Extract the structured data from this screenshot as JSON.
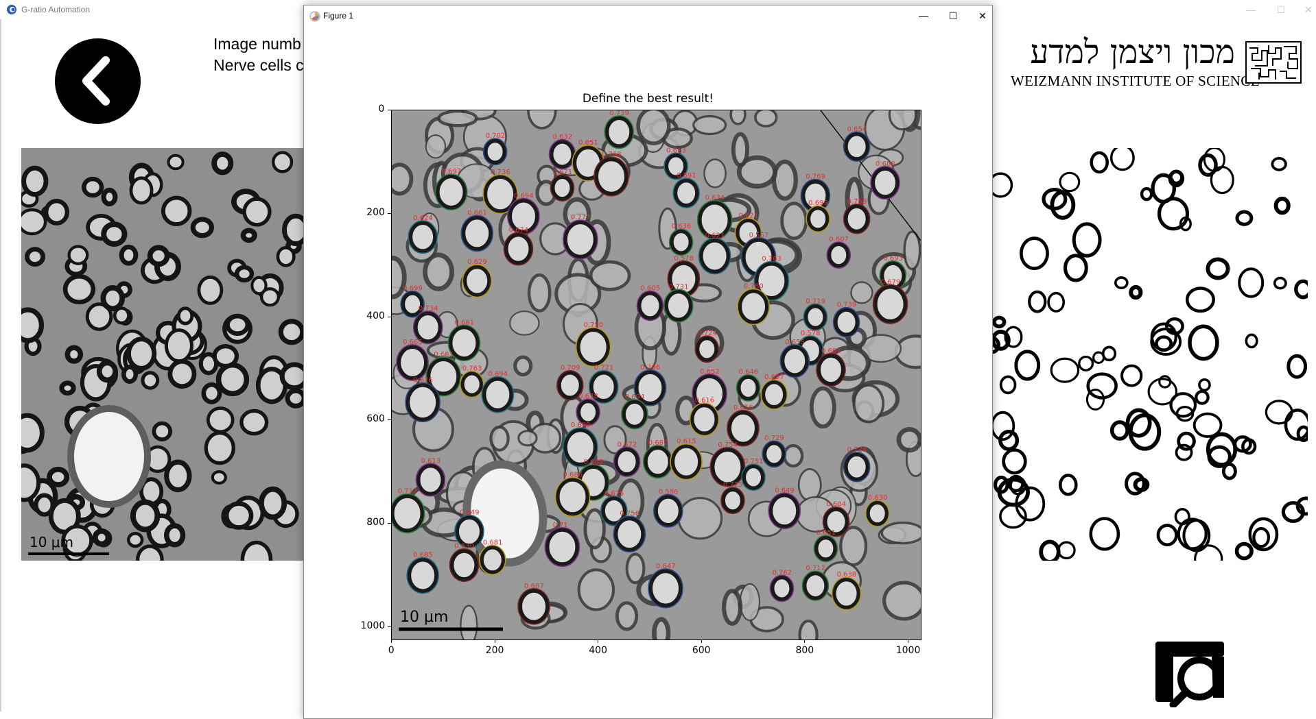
{
  "app": {
    "title": "G-ratio Automation",
    "controls": [
      "minimize-button",
      "maximize-button",
      "close-button"
    ],
    "info_line1": "Image numb",
    "info_line2": "Nerve cells c",
    "back_button": "chevron-left-icon",
    "magnify_button": "magnify-icon",
    "left_scale_label": "10 μm"
  },
  "logo": {
    "hebrew": "מכון ויצמן למדע",
    "english": "WEIZMANN INSTITUTE OF SCIENCE"
  },
  "figure_window": {
    "title": "Figure 1",
    "icon": "matplotlib-icon",
    "minimize": "—",
    "maximize": "☐",
    "close": "✕"
  },
  "plot": {
    "title": "Define the best result!",
    "scale_label": "10 μm"
  },
  "chart_data": {
    "type": "scatter",
    "title": "Define the best result!",
    "xlabel": "",
    "ylabel": "",
    "xlim": [
      0,
      1024
    ],
    "ylim": [
      1024,
      0
    ],
    "x_ticks": [
      0,
      200,
      400,
      600,
      800,
      1000
    ],
    "y_ticks": [
      0,
      200,
      400,
      600,
      800,
      1000
    ],
    "grid": false,
    "colors": {
      "label": "#e0302c",
      "image_bg": "#9a9a9a"
    },
    "points": [
      {
        "x": 200,
        "y": 80,
        "label": "0.702"
      },
      {
        "x": 330,
        "y": 85,
        "label": "0.632"
      },
      {
        "x": 440,
        "y": 42,
        "label": "0.739"
      },
      {
        "x": 380,
        "y": 102,
        "label": "0.651"
      },
      {
        "x": 425,
        "y": 128,
        "label": "0.768"
      },
      {
        "x": 550,
        "y": 108,
        "label": "0.613"
      },
      {
        "x": 900,
        "y": 70,
        "label": "0.654"
      },
      {
        "x": 955,
        "y": 140,
        "label": "0.668"
      },
      {
        "x": 115,
        "y": 158,
        "label": "0.697"
      },
      {
        "x": 210,
        "y": 162,
        "label": "0.736"
      },
      {
        "x": 330,
        "y": 150,
        "label": "0.671"
      },
      {
        "x": 570,
        "y": 160,
        "label": "0.591"
      },
      {
        "x": 820,
        "y": 165,
        "label": "0.769"
      },
      {
        "x": 255,
        "y": 205,
        "label": "0.694"
      },
      {
        "x": 625,
        "y": 212,
        "label": "0.634"
      },
      {
        "x": 825,
        "y": 210,
        "label": "0.699"
      },
      {
        "x": 900,
        "y": 210,
        "label": "0.758"
      },
      {
        "x": 60,
        "y": 245,
        "label": "0.624"
      },
      {
        "x": 165,
        "y": 238,
        "label": "0.661"
      },
      {
        "x": 365,
        "y": 250,
        "label": "0.777"
      },
      {
        "x": 560,
        "y": 255,
        "label": "0.636"
      },
      {
        "x": 690,
        "y": 237,
        "label": "0.621"
      },
      {
        "x": 245,
        "y": 268,
        "label": "0.674"
      },
      {
        "x": 625,
        "y": 282,
        "label": "0.621"
      },
      {
        "x": 710,
        "y": 284,
        "label": "0.567"
      },
      {
        "x": 865,
        "y": 280,
        "label": "0.607"
      },
      {
        "x": 970,
        "y": 320,
        "label": "0.693"
      },
      {
        "x": 165,
        "y": 330,
        "label": "0.629"
      },
      {
        "x": 565,
        "y": 326,
        "label": "0.578"
      },
      {
        "x": 735,
        "y": 330,
        "label": "0.763"
      },
      {
        "x": 40,
        "y": 375,
        "label": "0.699"
      },
      {
        "x": 500,
        "y": 378,
        "label": "0.605"
      },
      {
        "x": 555,
        "y": 378,
        "label": "0.731"
      },
      {
        "x": 700,
        "y": 380,
        "label": "0.780"
      },
      {
        "x": 965,
        "y": 375,
        "label": "0.679"
      },
      {
        "x": 820,
        "y": 400,
        "label": "0.719"
      },
      {
        "x": 880,
        "y": 410,
        "label": "0.739"
      },
      {
        "x": 70,
        "y": 420,
        "label": "0.734"
      },
      {
        "x": 140,
        "y": 450,
        "label": "0.681"
      },
      {
        "x": 390,
        "y": 458,
        "label": "0.790"
      },
      {
        "x": 610,
        "y": 462,
        "label": "0.724"
      },
      {
        "x": 810,
        "y": 465,
        "label": "0.578"
      },
      {
        "x": 780,
        "y": 485,
        "label": "0.655"
      },
      {
        "x": 40,
        "y": 488,
        "label": "0.665"
      },
      {
        "x": 100,
        "y": 515,
        "label": "0.681"
      },
      {
        "x": 155,
        "y": 530,
        "label": "0.763"
      },
      {
        "x": 345,
        "y": 532,
        "label": "0.709"
      },
      {
        "x": 410,
        "y": 535,
        "label": "0.721"
      },
      {
        "x": 500,
        "y": 537,
        "label": "0.756"
      },
      {
        "x": 615,
        "y": 548,
        "label": "0.652"
      },
      {
        "x": 690,
        "y": 537,
        "label": "0.646"
      },
      {
        "x": 740,
        "y": 550,
        "label": "0.657"
      },
      {
        "x": 850,
        "y": 502,
        "label": "0.691"
      },
      {
        "x": 205,
        "y": 550,
        "label": "0.694"
      },
      {
        "x": 60,
        "y": 565,
        "label": "0.676"
      },
      {
        "x": 380,
        "y": 584,
        "label": "0.638"
      },
      {
        "x": 470,
        "y": 588,
        "label": "0.694"
      },
      {
        "x": 605,
        "y": 598,
        "label": "0.616"
      },
      {
        "x": 680,
        "y": 615,
        "label": "0.656"
      },
      {
        "x": 365,
        "y": 652,
        "label": "0.699"
      },
      {
        "x": 740,
        "y": 665,
        "label": "0.729"
      },
      {
        "x": 455,
        "y": 680,
        "label": "0.672"
      },
      {
        "x": 515,
        "y": 680,
        "label": "0.687"
      },
      {
        "x": 570,
        "y": 680,
        "label": "0.615"
      },
      {
        "x": 650,
        "y": 690,
        "label": "0.754"
      },
      {
        "x": 700,
        "y": 710,
        "label": "0.751"
      },
      {
        "x": 900,
        "y": 690,
        "label": "0.734"
      },
      {
        "x": 75,
        "y": 715,
        "label": "0.613"
      },
      {
        "x": 390,
        "y": 720,
        "label": "0.665"
      },
      {
        "x": 350,
        "y": 748,
        "label": "0.686"
      },
      {
        "x": 660,
        "y": 755,
        "label": "0.725"
      },
      {
        "x": 430,
        "y": 775,
        "label": "0.675"
      },
      {
        "x": 535,
        "y": 775,
        "label": "0.586"
      },
      {
        "x": 760,
        "y": 775,
        "label": "0.649"
      },
      {
        "x": 30,
        "y": 780,
        "label": "0.712"
      },
      {
        "x": 940,
        "y": 780,
        "label": "0.630"
      },
      {
        "x": 860,
        "y": 796,
        "label": "0.604"
      },
      {
        "x": 150,
        "y": 815,
        "label": "0.649"
      },
      {
        "x": 460,
        "y": 820,
        "label": "0.758"
      },
      {
        "x": 330,
        "y": 845,
        "label": "0.71"
      },
      {
        "x": 840,
        "y": 848,
        "label": "0.651"
      },
      {
        "x": 195,
        "y": 870,
        "label": "0.681"
      },
      {
        "x": 140,
        "y": 880,
        "label": "0.630"
      },
      {
        "x": 60,
        "y": 900,
        "label": "0.685"
      },
      {
        "x": 530,
        "y": 925,
        "label": "0.647"
      },
      {
        "x": 755,
        "y": 925,
        "label": "0.762"
      },
      {
        "x": 820,
        "y": 920,
        "label": "0.712"
      },
      {
        "x": 880,
        "y": 935,
        "label": "0.638"
      },
      {
        "x": 275,
        "y": 960,
        "label": "0.687"
      }
    ]
  }
}
